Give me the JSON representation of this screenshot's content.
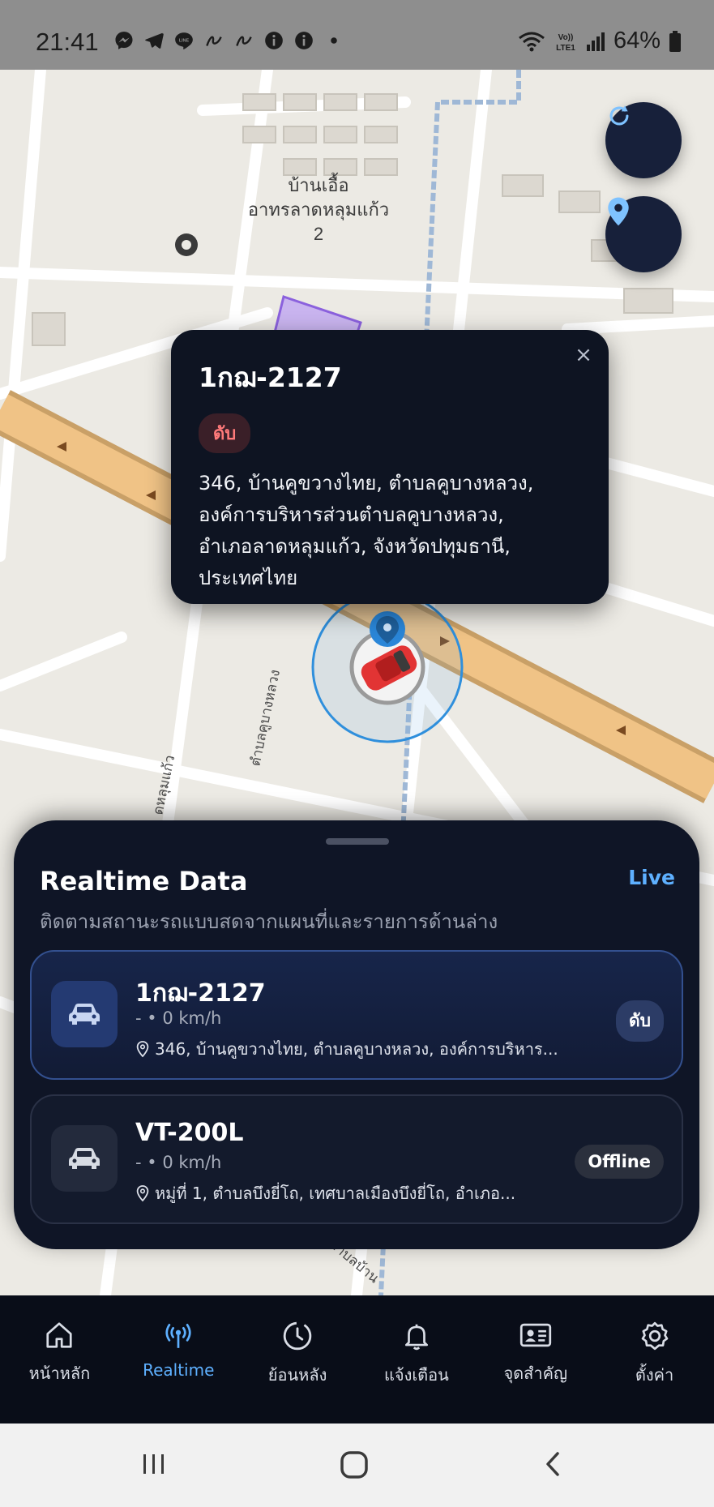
{
  "status_bar": {
    "time": "21:41",
    "battery": "64%",
    "left_icons": [
      "messenger-icon",
      "telegram-icon",
      "line-icon",
      "app-icon",
      "app-icon",
      "info-icon",
      "info-icon",
      "dot-icon"
    ],
    "right_icons": [
      "wifi-icon",
      "volte-icon",
      "signal-icon",
      "battery-icon"
    ]
  },
  "map": {
    "labels": {
      "building_line1": "บ้านเอื้อ",
      "building_line2": "อาทรลาดหลุมแก้ว",
      "building_line3": "2",
      "road1": "ตำบลคูบางหลวง",
      "road2": "ดหลุมแก้ว",
      "road3": "ตำบลบ้าน"
    },
    "buttons": {
      "refresh": "refresh-icon",
      "locate": "location-pin-icon"
    }
  },
  "popup": {
    "title": "1กฌ-2127",
    "status": "ดับ",
    "address_line1": "346, บ้านคูขวางไทย, ตำบลคูบางหลวง,",
    "address_line2": "องค์การบริหารส่วนตำบลคูบางหลวง,",
    "address_line3": "อำเภอลาดหลุมแก้ว, จังหวัดปทุมธานี,",
    "address_line4": "ประเทศไทย",
    "close_icon": "×"
  },
  "sheet": {
    "title": "Realtime Data",
    "live": "Live",
    "subtitle": "ติดตามสถานะรถแบบสดจากแผนที่และรายการด้านล่าง",
    "vehicles": [
      {
        "name": "1กฌ-2127",
        "speed": "- • 0 km/h",
        "address": "346, บ้านคูขวางไทย, ตำบลคูบางหลวง, องค์การบริหาร...",
        "status": "ดับ"
      },
      {
        "name": "VT-200L",
        "speed": "- • 0 km/h",
        "address": "หมู่ที่ 1, ตำบลบึงยี่โถ, เทศบาลเมืองบึงยี่โถ, อำเภอ...",
        "status": "Offline"
      }
    ]
  },
  "nav": {
    "items": [
      {
        "label": "หน้าหลัก",
        "icon": "home-icon"
      },
      {
        "label": "Realtime",
        "icon": "broadcast-icon"
      },
      {
        "label": "ย้อนหลัง",
        "icon": "history-icon"
      },
      {
        "label": "แจ้งเตือน",
        "icon": "bell-icon"
      },
      {
        "label": "จุดสำคัญ",
        "icon": "id-card-icon"
      },
      {
        "label": "ตั้งค่า",
        "icon": "gear-icon"
      }
    ],
    "active": "Realtime"
  },
  "system_nav": {
    "icons": [
      "recents-icon",
      "home-circle-icon",
      "back-icon"
    ]
  },
  "colors": {
    "accent": "#5eb0ff",
    "dark_panel": "#0f1526",
    "road": "#e9b66e",
    "off_red": "#ff7a7a"
  }
}
